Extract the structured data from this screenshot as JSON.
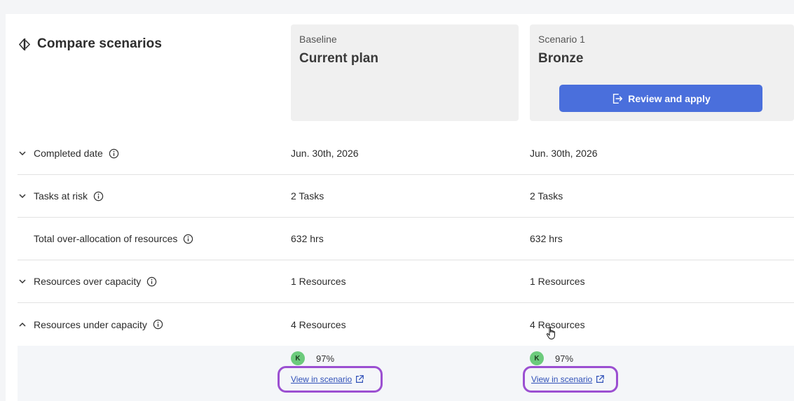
{
  "header": {
    "title": "Compare scenarios"
  },
  "columns": [
    {
      "subtitle": "Baseline",
      "name": "Current plan"
    },
    {
      "subtitle": "Scenario 1",
      "name": "Bronze",
      "action_label": "Review and apply"
    }
  ],
  "rows": [
    {
      "label": "Completed date",
      "expandable": true,
      "expanded": false,
      "values": [
        "Jun. 30th, 2026",
        "Jun. 30th, 2026"
      ]
    },
    {
      "label": "Tasks at risk",
      "expandable": true,
      "expanded": false,
      "values": [
        "2 Tasks",
        "2 Tasks"
      ]
    },
    {
      "label": "Total over-allocation of resources",
      "expandable": false,
      "values": [
        "632 hrs",
        "632 hrs"
      ]
    },
    {
      "label": "Resources over capacity",
      "expandable": true,
      "expanded": false,
      "values": [
        "1 Resources",
        "1 Resources"
      ]
    },
    {
      "label": "Resources under capacity",
      "expandable": true,
      "expanded": true,
      "values": [
        "4 Resources",
        "4 Resources"
      ]
    }
  ],
  "expanded_detail": {
    "entries": [
      {
        "avatar_initial": "K",
        "percent": "97%",
        "link_label": "View in scenario"
      },
      {
        "avatar_initial": "K",
        "percent": "97%",
        "link_label": "View in scenario"
      }
    ]
  },
  "colors": {
    "accent": "#4a6fdc",
    "highlight_outline": "#9b4fd1",
    "avatar": "#6ccb7c",
    "link": "#2f50b8"
  },
  "icons": {
    "title": "compare-scenarios-icon",
    "info": "info-icon",
    "chevron_down": "chevron-down-icon",
    "chevron_up": "chevron-up-icon",
    "apply": "sign-out-icon",
    "external": "external-link-icon"
  }
}
